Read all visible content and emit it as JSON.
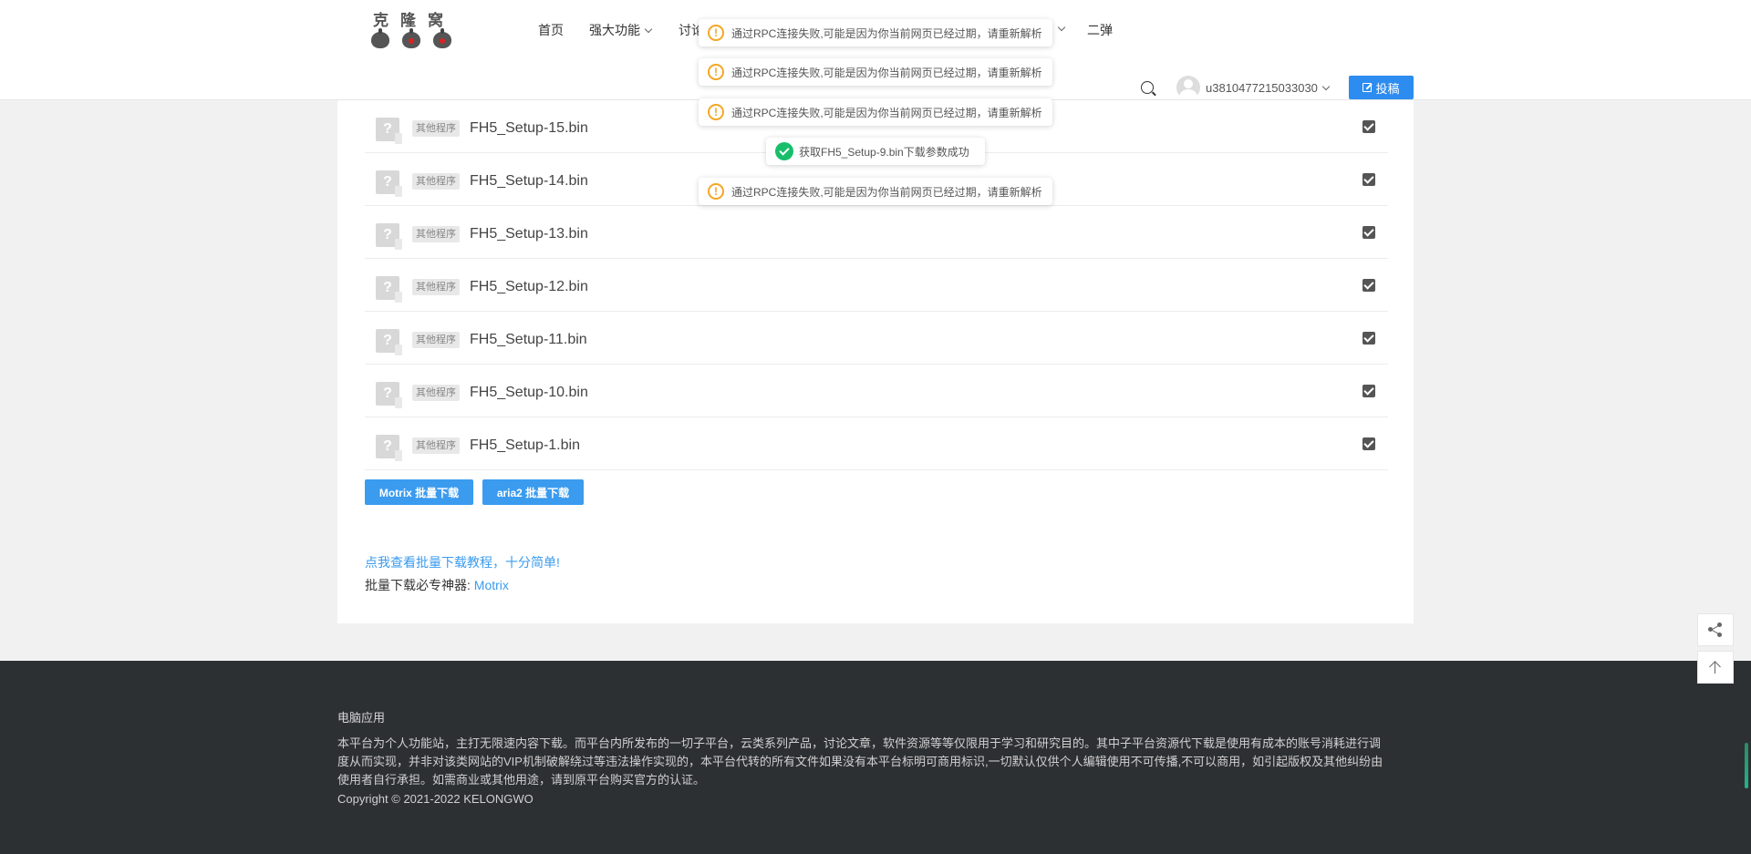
{
  "header": {
    "logo_chars": [
      "克",
      "隆",
      "窝"
    ],
    "nav": {
      "home": "首页",
      "features": "强大功能",
      "discuss": "讨论",
      "second": "二弹"
    },
    "username": "u3810477215033030",
    "post_label": "投稿"
  },
  "files": [
    {
      "tag": "其他程序",
      "name": "FH5_Setup-15.bin",
      "checked": true
    },
    {
      "tag": "其他程序",
      "name": "FH5_Setup-14.bin",
      "checked": true
    },
    {
      "tag": "其他程序",
      "name": "FH5_Setup-13.bin",
      "checked": true
    },
    {
      "tag": "其他程序",
      "name": "FH5_Setup-12.bin",
      "checked": true
    },
    {
      "tag": "其他程序",
      "name": "FH5_Setup-11.bin",
      "checked": true
    },
    {
      "tag": "其他程序",
      "name": "FH5_Setup-10.bin",
      "checked": true
    },
    {
      "tag": "其他程序",
      "name": "FH5_Setup-1.bin",
      "checked": true
    }
  ],
  "actions": {
    "motrix_batch": "Motrix 批量下载",
    "aria2_batch": "aria2 批量下载"
  },
  "tutorial_link": "点我查看批量下载教程，十分简单!",
  "tool_prefix": "批量下载必专神器:",
  "tool_link": "Motrix",
  "toasts": {
    "rpc_fail": "通过RPC连接失败,可能是因为你当前网页已经过期，请重新解析",
    "success": "获取FH5_Setup-9.bin下载参数成功"
  },
  "footer": {
    "title": "电脑应用",
    "text": "本平台为个人功能站，主打无限速内容下载。而平台内所发布的一切子平台，云类系列产品，讨论文章，软件资源等等仅限用于学习和研究目的。其中子平台资源代下载是使用有成本的账号消耗进行调度从而实现，并非对该类网站的VIP机制破解绕过等违法操作实现的，本平台代转的所有文件如果没有本平台标明可商用标识,一切默认仅供个人编辑使用不可传播,不可以商用，如引起版权及其他纠纷由使用者自行承担。如需商业或其他用途，请到原平台购买官方的认证。",
    "copyright": "Copyright © 2021-2022 KELONGWO"
  },
  "colors": {
    "accent": "#3a9bef",
    "footer_bg": "#2d3033",
    "warn": "#f5a623",
    "success": "#19be6b"
  }
}
